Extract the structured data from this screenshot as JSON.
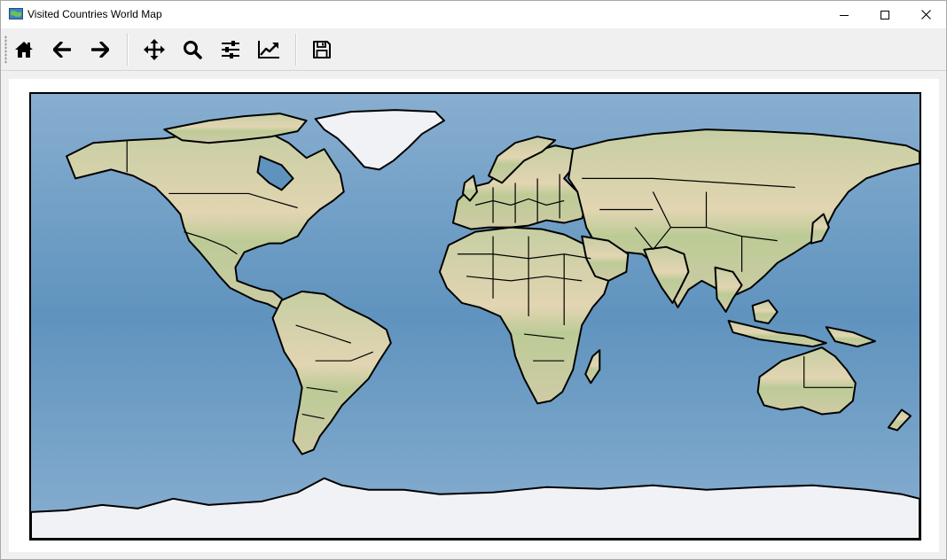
{
  "window": {
    "title": "Visited Countries World Map",
    "controls": [
      "minimize",
      "maximize",
      "close"
    ]
  },
  "toolbar": {
    "buttons": [
      {
        "name": "home",
        "icon": "home-icon"
      },
      {
        "name": "back",
        "icon": "arrow-left-icon"
      },
      {
        "name": "forward",
        "icon": "arrow-right-icon"
      },
      {
        "name": "pan",
        "icon": "move-icon"
      },
      {
        "name": "zoom",
        "icon": "magnifier-icon"
      },
      {
        "name": "configure-subplots",
        "icon": "sliders-icon"
      },
      {
        "name": "edit-axes",
        "icon": "line-chart-icon"
      },
      {
        "name": "save",
        "icon": "floppy-disk-icon"
      }
    ]
  },
  "map": {
    "projection": "PlateCarree",
    "extent": {
      "lon": [
        -180,
        180
      ],
      "lat": [
        -90,
        90
      ]
    },
    "features": [
      "stock image background",
      "country borders",
      "coastlines"
    ],
    "colors": {
      "ocean": "#6b9cc2",
      "land": "#d8d4a8",
      "land_green": "#c4cc98",
      "ice": "#f1f2f6",
      "border": "#000000"
    }
  }
}
